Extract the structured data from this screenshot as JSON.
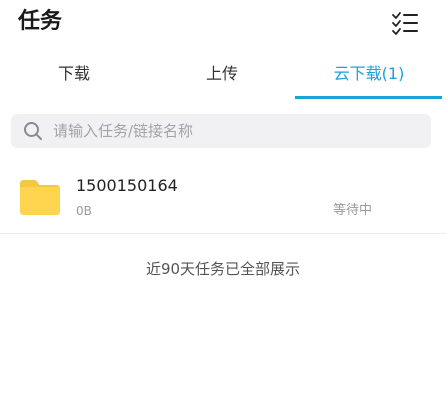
{
  "header": {
    "title": "任务",
    "menu_icon": "checklist-icon"
  },
  "tabs": [
    {
      "label": "下载",
      "active": false
    },
    {
      "label": "上传",
      "active": false
    },
    {
      "label": "云下载(1)",
      "active": true
    }
  ],
  "search": {
    "icon": "search-icon",
    "placeholder": "请输入任务/链接名称",
    "value": ""
  },
  "tasks": [
    {
      "icon": "folder-icon",
      "name": "1500150164",
      "size": "0B",
      "status": "等待中"
    }
  ],
  "footer": {
    "note": "近90天任务已全部展示"
  },
  "colors": {
    "accent": "#1aa3d8",
    "folder": "#ffd54f",
    "search_bg": "#f1f1f3"
  }
}
